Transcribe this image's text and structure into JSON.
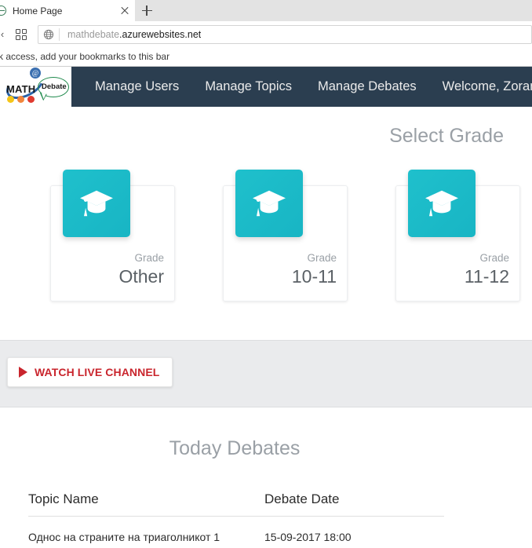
{
  "browser": {
    "tab": {
      "title": "Home Page",
      "favicon_name": "globe-favicon",
      "close_label": "×"
    },
    "new_tab_label": "+",
    "toolbar": {
      "grid_icon_name": "apps-grid-icon",
      "globe_icon_name": "globe-icon",
      "url_faded": "mathdebate",
      "url_bold": ".azurewebsites.net"
    },
    "bookmarks_bar": {
      "hint": "k access, add your bookmarks to this bar"
    }
  },
  "site": {
    "logo": {
      "math_text": "MATH",
      "debate_text": "Debate",
      "at_symbol": "@",
      "dot_colors": [
        "#f5c518",
        "#f2863c",
        "#e03a2f"
      ]
    },
    "nav": {
      "links": [
        {
          "label": "Manage Users"
        },
        {
          "label": "Manage Topics"
        },
        {
          "label": "Manage Debates"
        },
        {
          "label": "Welcome, Zoran.Trifu"
        }
      ]
    },
    "grade_section": {
      "title": "Select Grade",
      "cards": [
        {
          "label": "Grade",
          "value": "Other",
          "icon_name": "graduation-cap-icon"
        },
        {
          "label": "Grade",
          "value": "10-11",
          "icon_name": "graduation-cap-icon"
        },
        {
          "label": "Grade",
          "value": "11-12",
          "icon_name": "graduation-cap-icon"
        }
      ]
    },
    "live_channel": {
      "button_label": "WATCH LIVE CHANNEL",
      "play_icon_name": "play-triangle-icon"
    },
    "debates": {
      "title": "Today Debates",
      "columns": [
        "Topic Name",
        "Debate Date"
      ],
      "rows": [
        {
          "topic": "Однос на страните на триаголникот 1",
          "date": "15-09-2017 18:00"
        }
      ]
    }
  },
  "colors": {
    "navbar_bg": "#2b3e50",
    "card_accent": "#1fc0cc",
    "band_bg": "#eaebed",
    "live_red": "#c9252d",
    "muted_text": "#9aa0a6"
  }
}
